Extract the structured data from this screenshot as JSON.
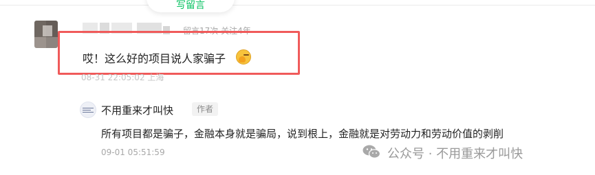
{
  "top_action": {
    "label": "写留言"
  },
  "comment": {
    "meta": "留言17次 关注4年",
    "text": "哎！这么好的项目说人家骗子",
    "time": "08-31 22:05:02 上海",
    "emoji": "facepalm-emoji"
  },
  "reply": {
    "name": "不用重来才叫快",
    "badge": "作者",
    "text": "所有项目都是骗子，金融本身就是骗局，说到根上，金融就是对劳动力和劳动价值的剥削",
    "time": "09-01 05:51:59"
  },
  "watermark": {
    "text": "公众号 · 不用重来才叫快",
    "icon": "wechat-icon"
  },
  "colors": {
    "highlight": "#f05a5a",
    "accent": "#07c160",
    "meta": "#a6a6a6"
  }
}
